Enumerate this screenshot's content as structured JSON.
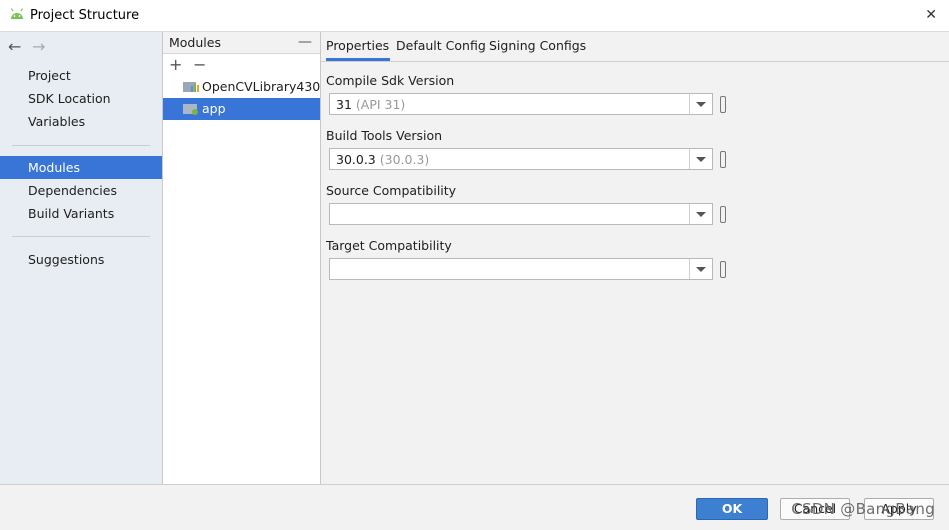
{
  "window": {
    "title": "Project Structure"
  },
  "nav": {
    "back": "←",
    "forward": "→",
    "items": [
      {
        "label": "Project"
      },
      {
        "label": "SDK Location"
      },
      {
        "label": "Variables"
      },
      {
        "label": "Modules"
      },
      {
        "label": "Dependencies"
      },
      {
        "label": "Build Variants"
      },
      {
        "label": "Suggestions"
      }
    ],
    "selected": "Modules"
  },
  "modules": {
    "header": "Modules",
    "minimize": "—",
    "add": "+",
    "remove": "−",
    "items": [
      {
        "label": "OpenCVLibrary430"
      },
      {
        "label": "app"
      }
    ],
    "selected": "app"
  },
  "tabs": [
    {
      "label": "Properties"
    },
    {
      "label": "Default Config"
    },
    {
      "label": "Signing Configs"
    }
  ],
  "active_tab": "Properties",
  "fields": [
    {
      "label": "Compile Sdk Version",
      "value": "31",
      "hint": "(API 31)"
    },
    {
      "label": "Build Tools Version",
      "value": "30.0.3",
      "hint": "(30.0.3)"
    },
    {
      "label": "Source Compatibility",
      "value": "",
      "hint": ""
    },
    {
      "label": "Target Compatibility",
      "value": "",
      "hint": ""
    }
  ],
  "buttons": {
    "ok": "OK",
    "cancel": "Cancel",
    "apply": "Apply"
  },
  "watermark": "CSDN @BangBang",
  "colors": {
    "selection": "#3875d7",
    "ok_button": "#3d7fd1"
  },
  "icons": {
    "app": "android-icon",
    "close": "close-icon",
    "module_library": "library-module-icon",
    "module_app": "app-module-icon"
  }
}
